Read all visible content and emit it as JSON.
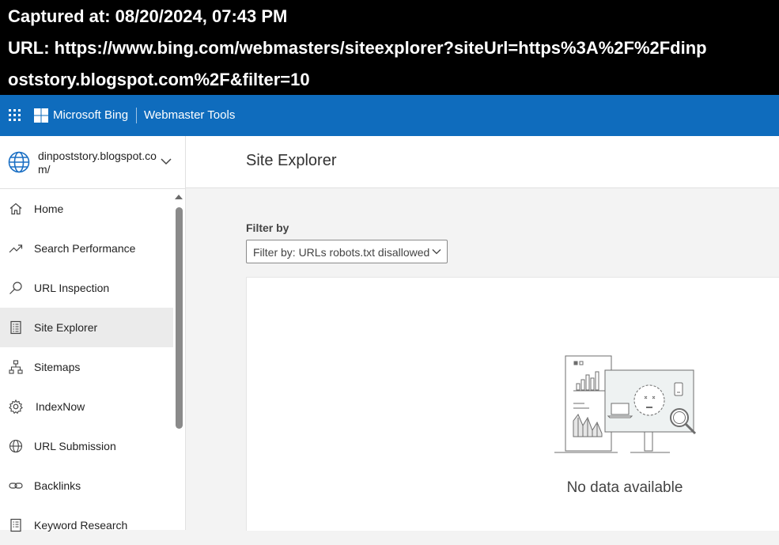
{
  "capture": {
    "captured_at": "Captured at: 08/20/2024, 07:43 PM",
    "url_line1": "URL: https://www.bing.com/webmasters/siteexplorer?siteUrl=https%3A%2F%2Fdinp",
    "url_line2": "oststory.blogspot.com%2F&filter=10"
  },
  "topbar": {
    "brand": "Microsoft Bing",
    "product": "Webmaster Tools",
    "color": "#0f6cbd"
  },
  "sidebar": {
    "site": "dinpoststory.blogspot.com/",
    "items": [
      {
        "label": "Home",
        "icon": "home-icon"
      },
      {
        "label": "Search Performance",
        "icon": "trend-icon"
      },
      {
        "label": "URL Inspection",
        "icon": "search-icon"
      },
      {
        "label": "Site Explorer",
        "icon": "document-icon",
        "active": true
      },
      {
        "label": "Sitemaps",
        "icon": "sitemap-icon"
      },
      {
        "label": "IndexNow",
        "icon": "gear-icon"
      },
      {
        "label": "URL Submission",
        "icon": "globe-icon"
      },
      {
        "label": "Backlinks",
        "icon": "link-icon"
      },
      {
        "label": "Keyword Research",
        "icon": "document-icon"
      }
    ]
  },
  "main": {
    "title": "Site Explorer",
    "filter_label": "Filter by",
    "filter_value": "Filter by: URLs robots.txt disallowed",
    "empty_message": "No data available"
  }
}
